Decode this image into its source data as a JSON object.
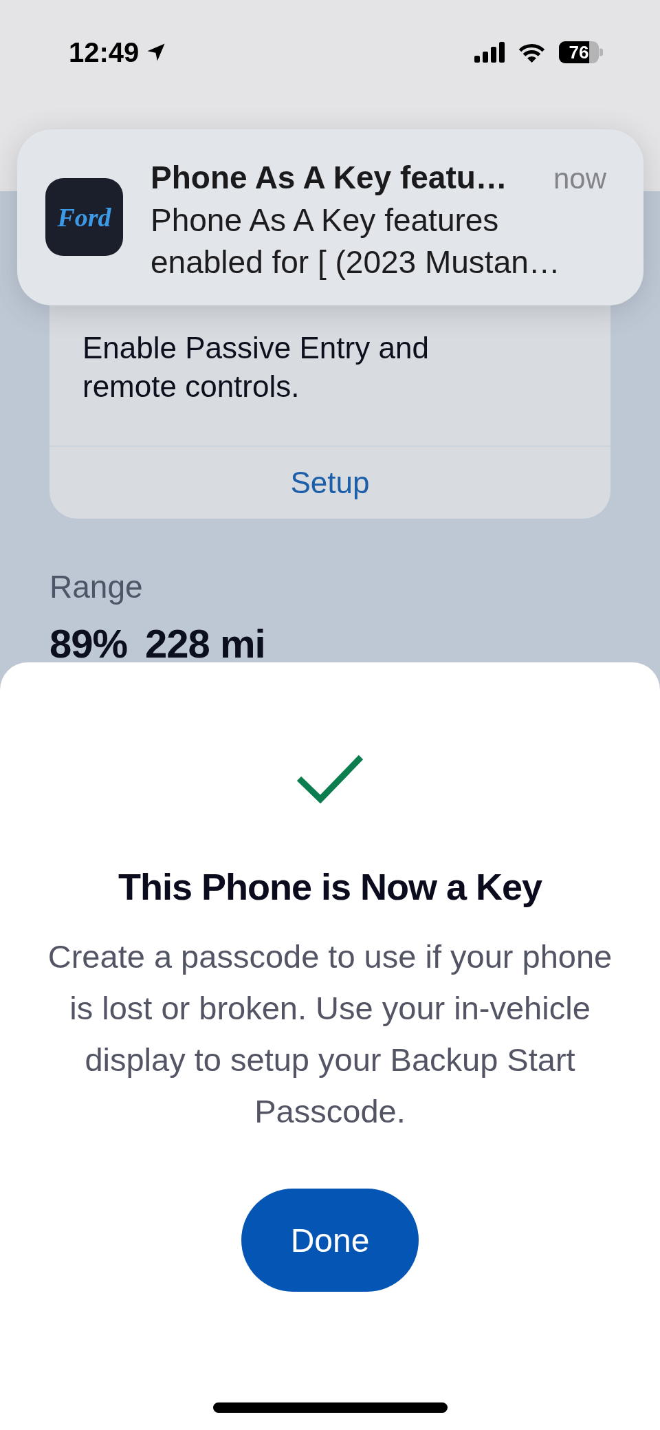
{
  "status_bar": {
    "time": "12:49",
    "battery": "76"
  },
  "notification": {
    "app_icon_text": "Ford",
    "title": "Phone As A Key featu…",
    "time": "now",
    "body": "Phone As A Key features enabled for [ (2023 Mustan…"
  },
  "card": {
    "description": "Enable Passive Entry and remote controls.",
    "action": "Setup"
  },
  "range": {
    "label": "Range",
    "values": [
      "89%",
      "228 mi"
    ]
  },
  "sheet": {
    "title": "This Phone is Now a Key",
    "message": "Create a passcode to use if your phone is lost or broken. Use your in-vehicle display to setup your Backup Start Passcode.",
    "button": "Done"
  }
}
